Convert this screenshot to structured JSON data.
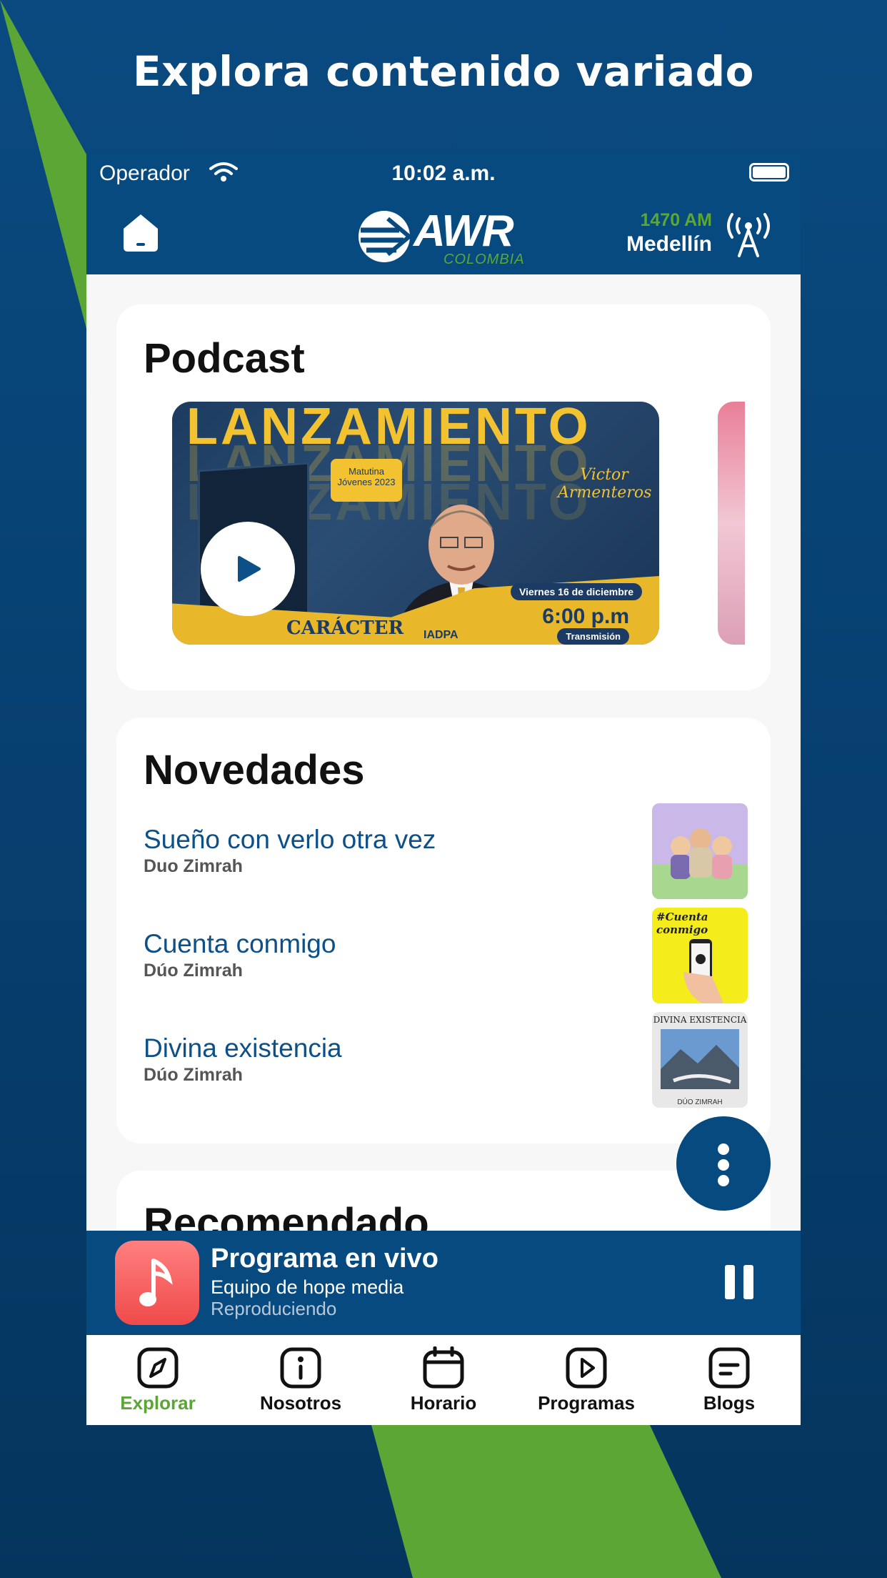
{
  "headline": "Explora contenido variado",
  "status_bar": {
    "carrier": "Operador",
    "time": "10:02 a.m."
  },
  "header": {
    "logo_text": "AWR",
    "logo_subtext": "COLOMBIA",
    "station_frequency": "1470 AM",
    "station_city": "Medellín",
    "home_icon": "home-icon",
    "antenna_icon": "antenna-icon"
  },
  "podcast": {
    "title": "Podcast",
    "items": [
      {
        "banner_text": "LANZAMIENTO",
        "bubble_text": "Matutina Jóvenes 2023",
        "speaker": "Victor Armenteros",
        "book": "CARÁCTER",
        "date": "Viernes 16 de diciembre",
        "hour": "6:00 p.m",
        "label": "Transmisión",
        "publisher": "IADPA"
      }
    ]
  },
  "novedades": {
    "title": "Novedades",
    "items": [
      {
        "title": "Sueño con verlo otra vez",
        "artist": "Duo Zimrah"
      },
      {
        "title": "Cuenta conmigo",
        "artist": "Dúo Zimrah",
        "thumb_text": "#Cuenta conmigo"
      },
      {
        "title": "Divina existencia",
        "artist": "Dúo Zimrah",
        "thumb_text": "DIVINA EXISTENCIA",
        "thumb_footer": "DÚO ZIMRAH"
      }
    ]
  },
  "recomendado": {
    "title": "Recomendado"
  },
  "player": {
    "title": "Programa en vivo",
    "subtitle": "Equipo de hope media",
    "status": "Reproduciendo",
    "icon": "music-note-icon"
  },
  "tabs": [
    {
      "label": "Explorar",
      "icon": "compass-icon",
      "active": true
    },
    {
      "label": "Nosotros",
      "icon": "info-icon",
      "active": false
    },
    {
      "label": "Horario",
      "icon": "calendar-icon",
      "active": false
    },
    {
      "label": "Programas",
      "icon": "play-icon",
      "active": false
    },
    {
      "label": "Blogs",
      "icon": "blog-icon",
      "active": false
    }
  ],
  "colors": {
    "brand_blue": "#064a80",
    "accent_green": "#5ba635",
    "link_blue": "#0d5088"
  }
}
